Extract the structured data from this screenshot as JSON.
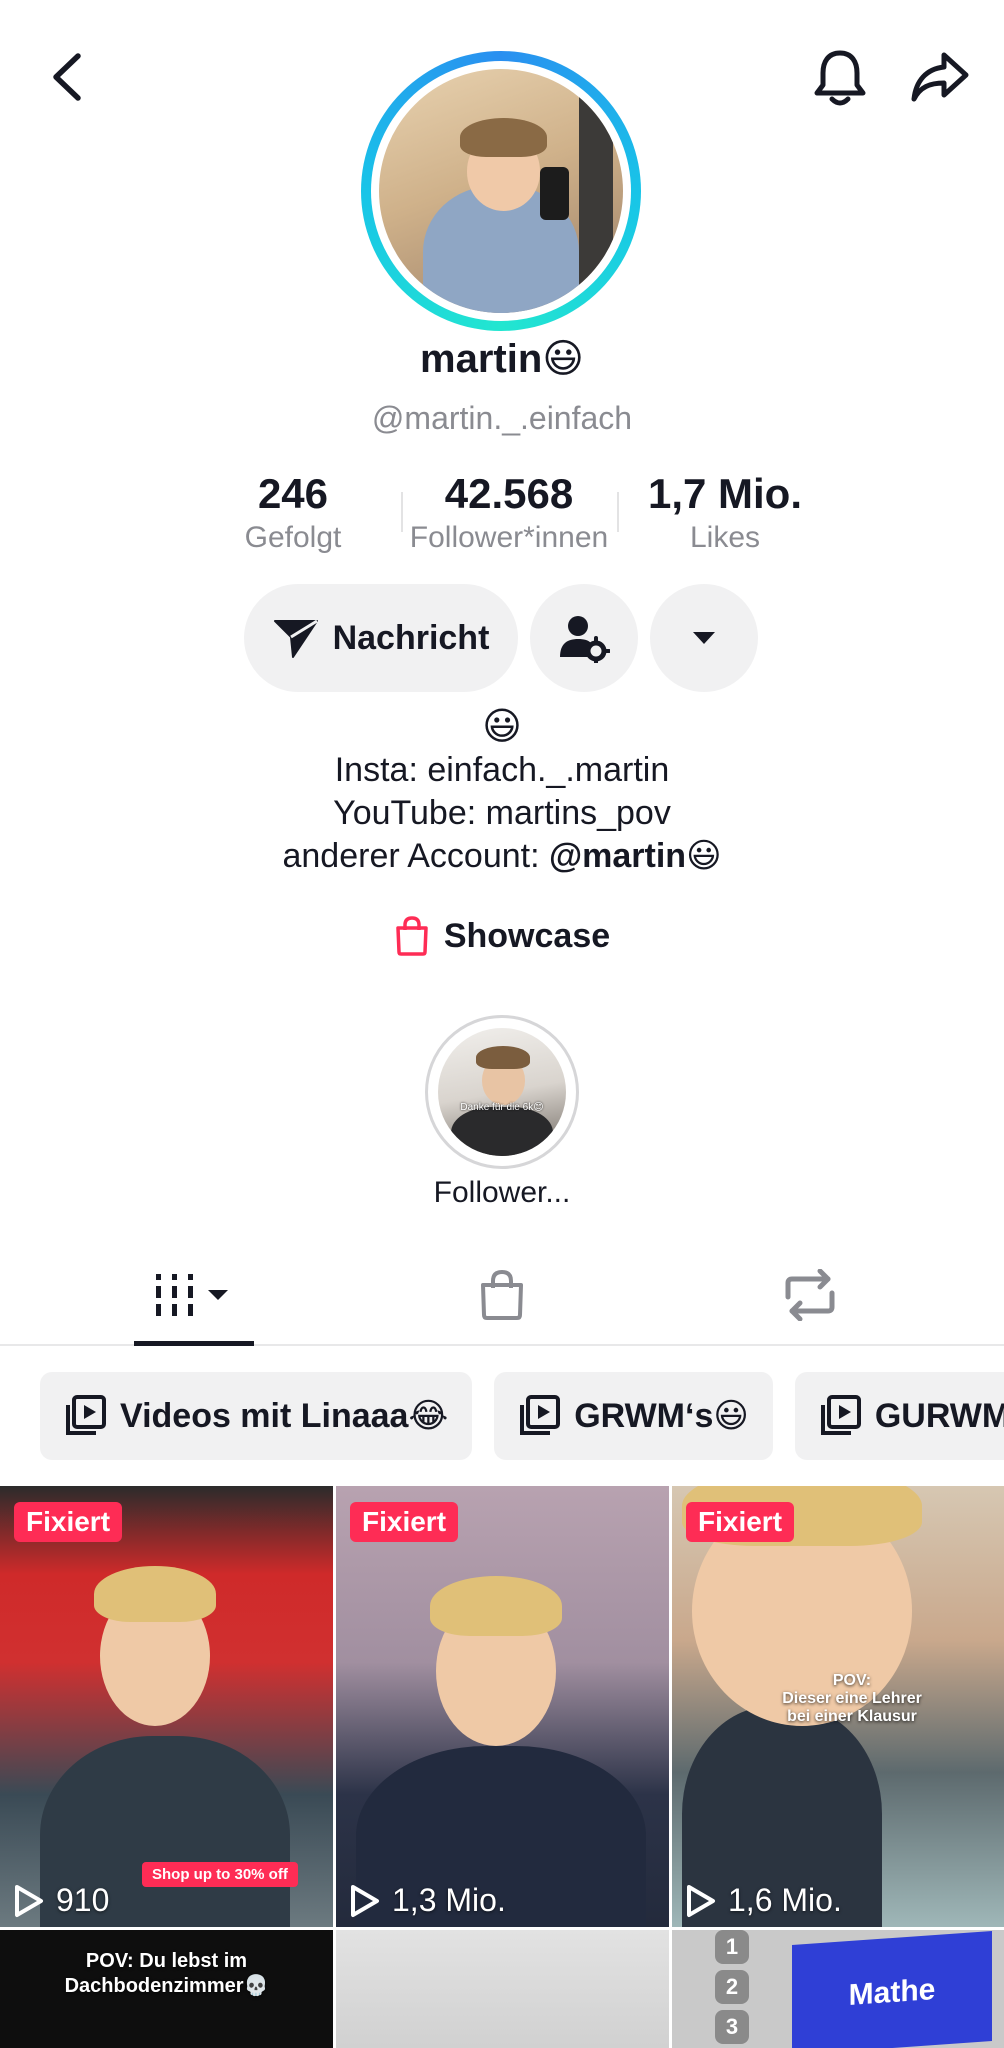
{
  "profile": {
    "display_name": "martin😃",
    "handle": "@martin._.einfach"
  },
  "stats": [
    {
      "value": "246",
      "label": "Gefolgt"
    },
    {
      "value": "42.568",
      "label": "Follower*innen"
    },
    {
      "value": "1,7 Mio.",
      "label": "Likes"
    }
  ],
  "actions": {
    "message_label": "Nachricht"
  },
  "bio": {
    "emoji_line": "😃",
    "line1": "Insta: einfach._.martin",
    "line2": "YouTube: martins_pov",
    "line3_prefix": "anderer Account: ",
    "line3_mention": "@martin😃"
  },
  "showcase": {
    "label": "Showcase"
  },
  "highlight": {
    "label": "Follower...",
    "overlay": "Danke für die 6k😊"
  },
  "playlists": [
    {
      "label": "Videos mit Linaaa😂"
    },
    {
      "label": "GRWM‘s😃"
    },
    {
      "label": "GURWM"
    }
  ],
  "videos": [
    {
      "pinned_label": "Fixiert",
      "views": "910",
      "shop_tag": "Shop up to 30% off"
    },
    {
      "pinned_label": "Fixiert",
      "views": "1,3 Mio."
    },
    {
      "pinned_label": "Fixiert",
      "views": "1,6 Mio.",
      "overlay": "POV:\nDieser eine Lehrer\nbei einer Klausur"
    },
    {
      "overlay": "POV: Du lebst im\nDachbodenzimmer💀"
    },
    {},
    {
      "overlay": "Mathe",
      "numbers": [
        "1",
        "2",
        "3"
      ]
    }
  ],
  "colors": {
    "accent_red": "#fe2c55",
    "text_primary": "#161823",
    "text_secondary": "#8a8b91",
    "pill_bg": "#f1f1f2"
  }
}
